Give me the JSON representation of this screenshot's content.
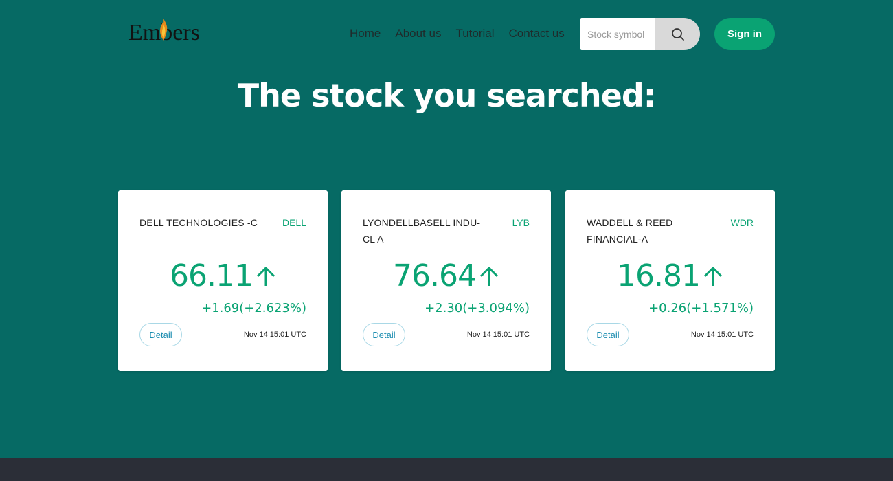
{
  "header": {
    "logo_text": "Embers",
    "nav": [
      "Home",
      "About us",
      "Tutorial",
      "Contact us"
    ],
    "search_placeholder": "Stock symbol",
    "search_icon": "search-icon",
    "signin_label": "Sign in"
  },
  "main": {
    "headline": "The stock you searched:",
    "cards": [
      {
        "name": "DELL TECHNOLOGIES -C",
        "symbol": "DELL",
        "price": "66.11",
        "direction_icon": "arrow-up-icon",
        "change": "+1.69(+2.623%)",
        "detail_label": "Detail",
        "time": "Nov 14 15:01 UTC"
      },
      {
        "name": "LYONDELLBASELL INDU-CL A",
        "symbol": "LYB",
        "price": "76.64",
        "direction_icon": "arrow-up-icon",
        "change": "+2.30(+3.094%)",
        "detail_label": "Detail",
        "time": "Nov 14 15:01 UTC"
      },
      {
        "name": "WADDELL & REED FINANCIAL-A",
        "symbol": "WDR",
        "price": "16.81",
        "direction_icon": "arrow-up-icon",
        "change": "+0.26(+1.571%)",
        "detail_label": "Detail",
        "time": "Nov 14 15:01 UTC"
      }
    ]
  },
  "colors": {
    "background": "#066a64",
    "accent_green": "#0aa373",
    "footer": "#2b2e37"
  }
}
